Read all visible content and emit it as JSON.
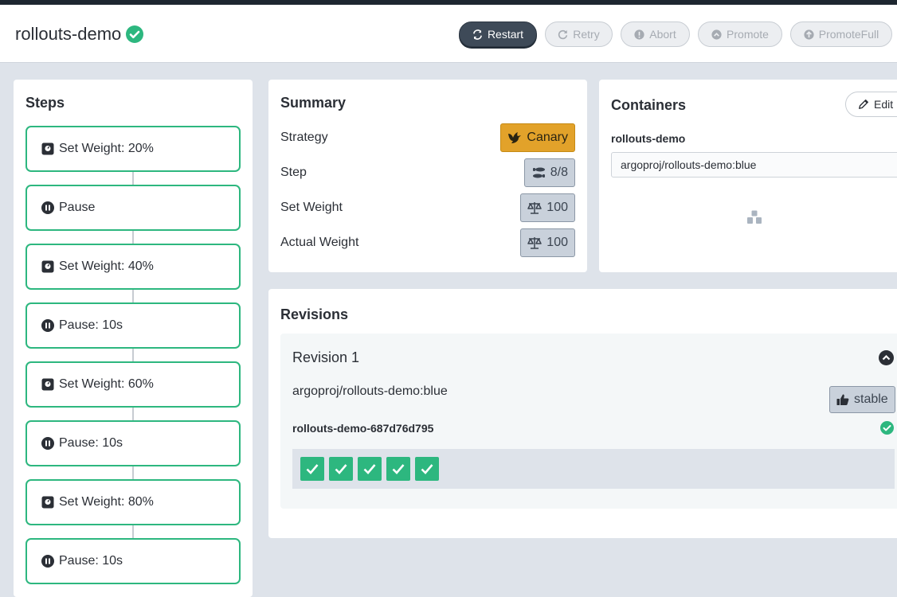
{
  "app": {
    "title": "rollouts-demo"
  },
  "header": {
    "buttons": [
      {
        "label": "Restart",
        "icon": "refresh-icon"
      },
      {
        "label": "Retry",
        "icon": "redo-icon"
      },
      {
        "label": "Abort",
        "icon": "exclamation-circle-icon"
      },
      {
        "label": "Promote",
        "icon": "chevron-up-circle-icon"
      },
      {
        "label": "PromoteFull",
        "icon": "arrow-up-circle-icon"
      }
    ]
  },
  "steps": {
    "title": "Steps",
    "items": [
      {
        "label": "Set Weight: 20%",
        "icon": "weight-icon"
      },
      {
        "label": "Pause",
        "icon": "pause-icon"
      },
      {
        "label": "Set Weight: 40%",
        "icon": "weight-icon"
      },
      {
        "label": "Pause: 10s",
        "icon": "pause-icon"
      },
      {
        "label": "Set Weight: 60%",
        "icon": "weight-icon"
      },
      {
        "label": "Pause: 10s",
        "icon": "pause-icon"
      },
      {
        "label": "Set Weight: 80%",
        "icon": "weight-icon"
      },
      {
        "label": "Pause: 10s",
        "icon": "pause-icon"
      }
    ]
  },
  "summary": {
    "title": "Summary",
    "rows": [
      {
        "label": "Strategy",
        "value": "Canary",
        "icon": "dove-icon"
      },
      {
        "label": "Step",
        "value": "8/8",
        "icon": "shoe-prints-icon"
      },
      {
        "label": "Set Weight",
        "value": "100",
        "icon": "balance-scale-icon"
      },
      {
        "label": "Actual Weight",
        "value": "100",
        "icon": "balance-scale-icon"
      }
    ]
  },
  "containers": {
    "title": "Containers",
    "edit_label": "Edit",
    "name": "rollouts-demo",
    "image": "argoproj/rollouts-demo:blue"
  },
  "revisions": {
    "title": "Revisions",
    "items": [
      {
        "label": "Revision 1",
        "image": "argoproj/rollouts-demo:blue",
        "badge": "stable",
        "replicaset": "rollouts-demo-687d76d795",
        "pods": 5
      }
    ]
  },
  "colors": {
    "success": "#2db77f",
    "canary": "#e2a22a",
    "dark": "#3e4a58"
  }
}
